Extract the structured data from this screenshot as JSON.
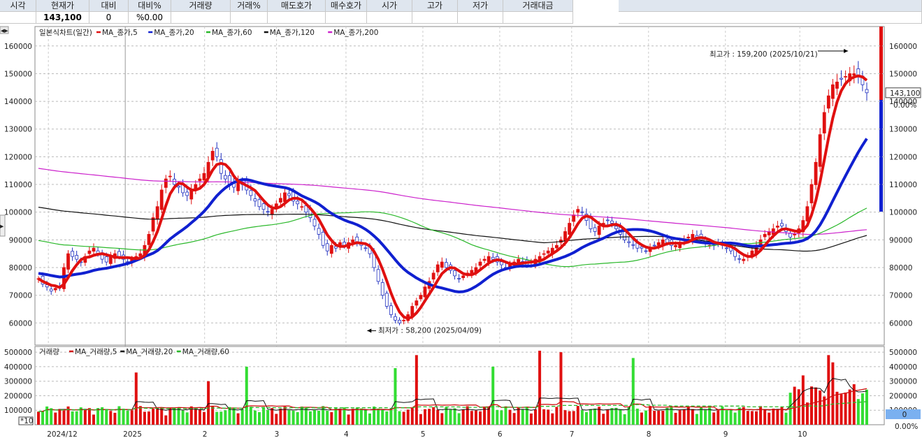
{
  "quote_bar": {
    "headers": [
      "시각",
      "현재가",
      "대비",
      "대비%",
      "거래량",
      "거래%",
      "매도호가",
      "매수호가",
      "시가",
      "고가",
      "저가",
      "거래대금"
    ],
    "values": [
      "",
      "143,100",
      "0",
      "%0.00",
      "",
      "",
      "",
      "",
      "",
      "",
      "",
      ""
    ]
  },
  "colors": {
    "up": "#e01010",
    "down": "#1020e0",
    "ma5": "#e01010",
    "ma20": "#1020d0",
    "ma60": "#2ab82a",
    "ma120": "#111111",
    "ma200": "#cc22cc",
    "vol_up": "#e01010",
    "vol_down": "#33dd33"
  },
  "chart_data": [
    {
      "type": "candlestick",
      "title": "일본식차트(일간)",
      "legend": [
        "MA_종가,5",
        "MA_종가,20",
        "MA_종가,60",
        "MA_종가,120",
        "MA_종가,200"
      ],
      "y_ticks_left": [
        "160000",
        "150000",
        "140000",
        "130000",
        "120000",
        "110000",
        "100000",
        "90000",
        "80000",
        "70000",
        "60000"
      ],
      "y_ticks_right": [
        "160000",
        "150000",
        "140000",
        "130000",
        "120000",
        "110000",
        "100000",
        "90000",
        "80000",
        "70000",
        "60000"
      ],
      "ylim": [
        52000,
        166000
      ],
      "x_labels": [
        "2024/12",
        "2025",
        "2",
        "3",
        "4",
        "5",
        "6",
        "7",
        "8",
        "9",
        "10"
      ],
      "x_label_dates": [
        "2024-12-02",
        "2025-01-02",
        "2025-02-03",
        "2025-03-04",
        "2025-04-01",
        "2025-05-02",
        "2025-06-02",
        "2025-07-01",
        "2025-08-01",
        "2025-09-01",
        "2025-10-01"
      ],
      "date_range": [
        "2024-11-28",
        "2025-10-28"
      ],
      "close": [
        76000,
        74000,
        73000,
        71500,
        72500,
        73000,
        80000,
        85000,
        84000,
        83000,
        82000,
        84000,
        86000,
        87000,
        85000,
        83000,
        82000,
        84000,
        85000,
        84000,
        83000,
        82000,
        83000,
        84000,
        85000,
        88000,
        92000,
        98000,
        102000,
        108000,
        112000,
        113000,
        110000,
        109000,
        107000,
        106000,
        108000,
        110000,
        112000,
        114000,
        118000,
        122000,
        120000,
        114000,
        112000,
        110000,
        109000,
        111000,
        110000,
        108000,
        106000,
        104000,
        102000,
        101000,
        100000,
        101000,
        103000,
        105000,
        107000,
        106000,
        104000,
        103000,
        102000,
        100000,
        98000,
        95000,
        92000,
        88000,
        86000,
        88000,
        87000,
        89000,
        88000,
        89000,
        90000,
        89000,
        88000,
        87000,
        85000,
        80000,
        75000,
        70000,
        66000,
        63000,
        61000,
        60000,
        61000,
        63000,
        66000,
        68000,
        70000,
        73000,
        75000,
        78000,
        81000,
        82000,
        80000,
        79000,
        77000,
        76000,
        77000,
        78000,
        79000,
        80000,
        82000,
        83000,
        84000,
        83000,
        82000,
        81000,
        80000,
        81000,
        82000,
        83000,
        82000,
        81000,
        82000,
        83000,
        84000,
        85000,
        86000,
        87000,
        88000,
        90000,
        93000,
        96000,
        99000,
        101000,
        100000,
        97000,
        94000,
        93000,
        95000,
        96000,
        97000,
        96000,
        94000,
        92000,
        90000,
        89000,
        88000,
        87000,
        87000,
        86000,
        87000,
        88000,
        89000,
        90000,
        89000,
        88000,
        88000,
        89000,
        90000,
        91000,
        92000,
        91000,
        90000,
        89000,
        88000,
        88000,
        89000,
        88000,
        87000,
        86000,
        84000,
        83000,
        83000,
        84000,
        86000,
        88000,
        90000,
        92000,
        93000,
        94000,
        95000,
        95000,
        93000,
        91000,
        92000,
        94000,
        97000,
        102000,
        110000,
        118000,
        128000,
        136000,
        142000,
        146000,
        147000,
        148000,
        149000,
        150000,
        150000,
        149000,
        146000,
        143100
      ],
      "high_point": {
        "label": "최고가 : 159,200 (2025/10/21)",
        "value": 159200,
        "date": "2025-10-21"
      },
      "low_point": {
        "label": "최저가 : 58,200 (2025/04/09)",
        "value": 58200,
        "date": "2025-04-09"
      },
      "current_price_tag": "143,100",
      "current_change_tag": "0.00%"
    },
    {
      "type": "bar",
      "title": "거래량",
      "legend": [
        "MA_거래량,5",
        "MA_거래량,20",
        "MA_거래량,60"
      ],
      "y_ticks_left": [
        "500000",
        "400000",
        "300000",
        "200000",
        "100000"
      ],
      "y_ticks_right": [
        "500000",
        "400000",
        "300000",
        "200000",
        "100000"
      ],
      "ylim": [
        0,
        520000
      ],
      "multiplier_label": "*10",
      "current_volume_tag": "0",
      "current_volume_change": "0.00%",
      "volume_spikes": [
        {
          "date": "2025-01-06",
          "value": 360000
        },
        {
          "date": "2025-02-05",
          "value": 300000
        },
        {
          "date": "2025-02-20",
          "value": 400000
        },
        {
          "date": "2025-04-21",
          "value": 390000
        },
        {
          "date": "2025-04-30",
          "value": 480000
        },
        {
          "date": "2025-05-30",
          "value": 400000
        },
        {
          "date": "2025-06-18",
          "value": 510000
        },
        {
          "date": "2025-06-27",
          "value": 500000
        },
        {
          "date": "2025-07-25",
          "value": 460000
        },
        {
          "date": "2025-10-02",
          "value": 340000
        },
        {
          "date": "2025-10-13",
          "value": 480000
        },
        {
          "date": "2025-10-14",
          "value": 430000
        }
      ]
    }
  ]
}
